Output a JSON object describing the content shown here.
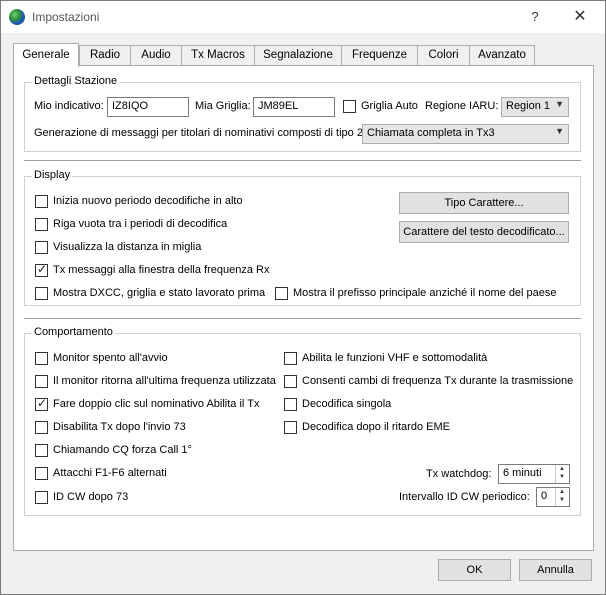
{
  "window": {
    "title": "Impostazioni",
    "help": "?",
    "close": "✕"
  },
  "tabs": [
    {
      "label": "Generale",
      "active": true
    },
    {
      "label": "Radio"
    },
    {
      "label": "Audio"
    },
    {
      "label": "Tx Macros"
    },
    {
      "label": "Segnalazione"
    },
    {
      "label": "Frequenze"
    },
    {
      "label": "Colori"
    },
    {
      "label": "Avanzato"
    }
  ],
  "station": {
    "title": "Dettagli Stazione",
    "callsign_label": "Mio indicativo:",
    "callsign_value": "IZ8IQO",
    "grid_label": "Mia Griglia:",
    "grid_value": "JM89EL",
    "auto_grid_label": "Griglia Auto",
    "iaru_label": "Regione IARU:",
    "iaru_value": "Region 1",
    "compound_label": "Generazione di messaggi per titolari di nominativi composti di tipo 2:",
    "compound_value": "Chiamata completa in Tx3"
  },
  "display": {
    "title": "Display",
    "items": [
      {
        "label": "Inizia nuovo periodo decodifiche in alto",
        "checked": false
      },
      {
        "label": "Riga vuota tra i periodi di decodifica",
        "checked": false
      },
      {
        "label": "Visualizza la distanza in miglia",
        "checked": false
      },
      {
        "label": "Tx messaggi alla finestra della frequenza Rx",
        "checked": true
      },
      {
        "label": "Mostra DXCC, griglia e stato lavorato prima",
        "checked": false
      },
      {
        "label": "Mostra il prefisso principale anziché il nome del paese",
        "checked": false
      }
    ],
    "font_button": "Tipo Carattere...",
    "decoded_font_button": "Carattere del testo decodificato..."
  },
  "behavior": {
    "title": "Comportamento",
    "left": [
      {
        "label": "Monitor spento all'avvio",
        "checked": false
      },
      {
        "label": "Il monitor ritorna all'ultima frequenza utilizzata",
        "checked": false
      },
      {
        "label": "Fare doppio clic sul nominativo Abilita il Tx",
        "checked": true
      },
      {
        "label": "Disabilita Tx dopo l'invio 73",
        "checked": false
      },
      {
        "label": "Chiamando CQ forza Call 1°",
        "checked": false
      },
      {
        "label": "Attacchi F1-F6 alternati",
        "checked": false
      },
      {
        "label": "ID CW dopo 73",
        "checked": false
      }
    ],
    "right": [
      {
        "label": "Abilita le funzioni VHF e sottomodalità",
        "checked": false
      },
      {
        "label": "Consenti cambi di frequenza Tx durante la trasmissione",
        "checked": false
      },
      {
        "label": "Decodifica singola",
        "checked": false
      },
      {
        "label": "Decodifica dopo il ritardo EME",
        "checked": false
      }
    ],
    "watchdog_label": "Tx watchdog:",
    "watchdog_value": "6 minuti",
    "cw_id_label": "Intervallo ID CW periodico:",
    "cw_id_value": "0"
  },
  "buttons": {
    "ok": "OK",
    "cancel": "Annulla"
  }
}
